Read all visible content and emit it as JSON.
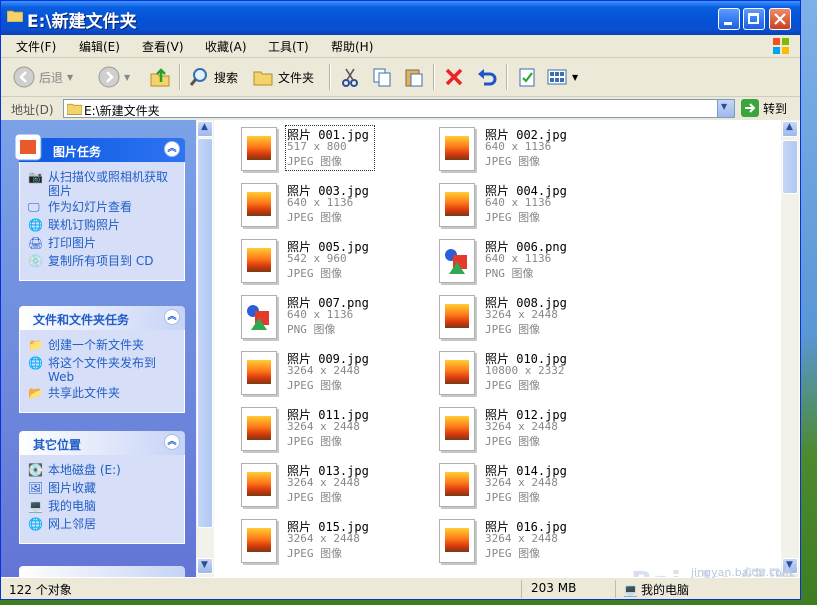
{
  "window": {
    "title": "E:\\新建文件夹",
    "controls": [
      "minimize",
      "maximize",
      "close"
    ]
  },
  "menubar": {
    "items": [
      "文件(F)",
      "编辑(E)",
      "查看(V)",
      "收藏(A)",
      "工具(T)",
      "帮助(H)"
    ]
  },
  "toolbar": {
    "back_label": "后退",
    "search_label": "搜索",
    "folders_label": "文件夹"
  },
  "address": {
    "label": "地址(D)",
    "value": "E:\\新建文件夹",
    "go_label": "转到"
  },
  "sidebar": {
    "picture_tasks": {
      "title": "图片任务",
      "items": [
        "从扫描仪或照相机获取图片",
        "作为幻灯片查看",
        "联机订购照片",
        "打印图片",
        "复制所有项目到 CD"
      ]
    },
    "file_tasks": {
      "title": "文件和文件夹任务",
      "items": [
        "创建一个新文件夹",
        "将这个文件夹发布到 Web",
        "共享此文件夹"
      ]
    },
    "other_places": {
      "title": "其它位置",
      "items": [
        "本地磁盘 (E:)",
        "图片收藏",
        "我的电脑",
        "网上邻居"
      ]
    }
  },
  "files": [
    {
      "name": "照片 001.jpg",
      "dims": "517 x 800",
      "type": "JPEG 图像",
      "kind": "jpg"
    },
    {
      "name": "照片 002.jpg",
      "dims": "640 x 1136",
      "type": "JPEG 图像",
      "kind": "jpg"
    },
    {
      "name": "照片 003.jpg",
      "dims": "640 x 1136",
      "type": "JPEG 图像",
      "kind": "jpg"
    },
    {
      "name": "照片 004.jpg",
      "dims": "640 x 1136",
      "type": "JPEG 图像",
      "kind": "jpg"
    },
    {
      "name": "照片 005.jpg",
      "dims": "542 x 960",
      "type": "JPEG 图像",
      "kind": "jpg"
    },
    {
      "name": "照片 006.png",
      "dims": "640 x 1136",
      "type": "PNG 图像",
      "kind": "png"
    },
    {
      "name": "照片 007.png",
      "dims": "640 x 1136",
      "type": "PNG 图像",
      "kind": "png"
    },
    {
      "name": "照片 008.jpg",
      "dims": "3264 x 2448",
      "type": "JPEG 图像",
      "kind": "jpg"
    },
    {
      "name": "照片 009.jpg",
      "dims": "3264 x 2448",
      "type": "JPEG 图像",
      "kind": "jpg"
    },
    {
      "name": "照片 010.jpg",
      "dims": "10800 x 2332",
      "type": "JPEG 图像",
      "kind": "jpg"
    },
    {
      "name": "照片 011.jpg",
      "dims": "3264 x 2448",
      "type": "JPEG 图像",
      "kind": "jpg"
    },
    {
      "name": "照片 012.jpg",
      "dims": "3264 x 2448",
      "type": "JPEG 图像",
      "kind": "jpg"
    },
    {
      "name": "照片 013.jpg",
      "dims": "3264 x 2448",
      "type": "JPEG 图像",
      "kind": "jpg"
    },
    {
      "name": "照片 014.jpg",
      "dims": "3264 x 2448",
      "type": "JPEG 图像",
      "kind": "jpg"
    },
    {
      "name": "照片 015.jpg",
      "dims": "3264 x 2448",
      "type": "JPEG 图像",
      "kind": "jpg"
    },
    {
      "name": "照片 016.jpg",
      "dims": "3264 x 2448",
      "type": "JPEG 图像",
      "kind": "jpg"
    }
  ],
  "status": {
    "count": "122 个对象",
    "size": "203 MB",
    "location": "我的电脑"
  },
  "watermark": {
    "brand": "Bai du 经验",
    "url": "jingyan.baidu.com"
  }
}
